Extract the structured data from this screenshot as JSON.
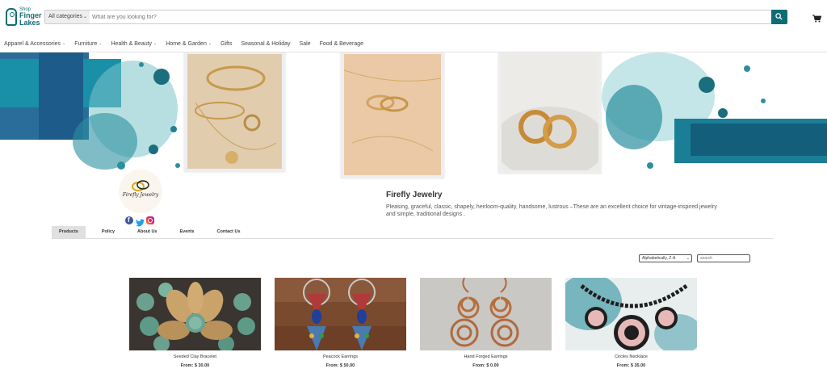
{
  "logo": {
    "line1": "Shop",
    "line2": "Finger",
    "line3": "Lakes"
  },
  "search": {
    "category": "All categories",
    "placeholder": "What are you looking for?"
  },
  "nav": [
    {
      "label": "Apparel & Accessories",
      "dropdown": true
    },
    {
      "label": "Furniture",
      "dropdown": true
    },
    {
      "label": "Health & Beauty",
      "dropdown": true
    },
    {
      "label": "Home & Garden",
      "dropdown": true
    },
    {
      "label": "Gifts",
      "dropdown": false
    },
    {
      "label": "Seasonal & Holiday",
      "dropdown": false
    },
    {
      "label": "Sale",
      "dropdown": false
    },
    {
      "label": "Food & Beverage",
      "dropdown": false
    }
  ],
  "store": {
    "logo_text": "Firefly Jewelry",
    "title": "Firefly Jewelry",
    "description": "Pleasing, graceful, classic, shapely, heirloom-quality, handsome, lustrous –These are an excellent choice for vintage-inspired jewelry and simple, traditional designs ."
  },
  "tabs": [
    {
      "label": "Products",
      "active": true
    },
    {
      "label": "Policy",
      "active": false
    },
    {
      "label": "About Us",
      "active": false
    },
    {
      "label": "Events",
      "active": false
    },
    {
      "label": "Contact Us",
      "active": false
    }
  ],
  "sort": {
    "selected": "Alphabetically, Z-A"
  },
  "store_search": {
    "placeholder": "search"
  },
  "products": [
    {
      "name": "Seeded Clay Bracelet",
      "price": "From: $ 30.00"
    },
    {
      "name": "Peacock Earrings",
      "price": "From: $ 50.00"
    },
    {
      "name": "Hand Forged Earrings",
      "price": "From: $ 0.00"
    },
    {
      "name": "Circles Necklace",
      "price": "From: $ 35.00"
    }
  ],
  "colors": {
    "brand": "#0e6c74",
    "teal_paint": "#1d8da0"
  }
}
